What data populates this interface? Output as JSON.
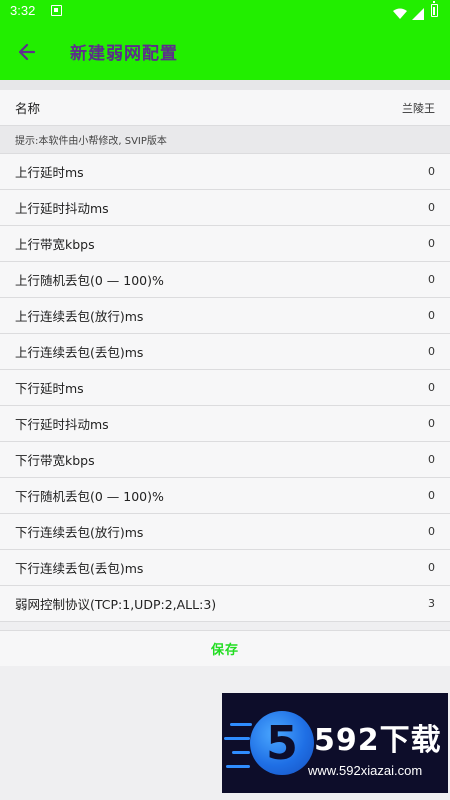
{
  "status_bar": {
    "time": "3:32"
  },
  "app_bar": {
    "title": "新建弱网配置"
  },
  "name_row": {
    "label": "名称",
    "value": "兰陵王"
  },
  "hint": "提示:本软件由小帮修改, SVIP版本",
  "settings": [
    {
      "label": "上行延时ms",
      "value": "0"
    },
    {
      "label": "上行延时抖动ms",
      "value": "0"
    },
    {
      "label": "上行带宽kbps",
      "value": "0"
    },
    {
      "label": "上行随机丢包(0 — 100)%",
      "value": "0"
    },
    {
      "label": "上行连续丢包(放行)ms",
      "value": "0"
    },
    {
      "label": "上行连续丢包(丢包)ms",
      "value": "0"
    },
    {
      "label": "下行延时ms",
      "value": "0"
    },
    {
      "label": "下行延时抖动ms",
      "value": "0"
    },
    {
      "label": "下行带宽kbps",
      "value": "0"
    },
    {
      "label": "下行随机丢包(0 — 100)%",
      "value": "0"
    },
    {
      "label": "下行连续丢包(放行)ms",
      "value": "0"
    },
    {
      "label": "下行连续丢包(丢包)ms",
      "value": "0"
    },
    {
      "label": "弱网控制协议(TCP:1,UDP:2,ALL:3)",
      "value": "3"
    }
  ],
  "save_label": "保存",
  "watermark": {
    "brand": "592下载",
    "url": "www.592xiazai.com",
    "badge": "5"
  },
  "colors": {
    "accent": "#22ee00",
    "title_text": "#5d2d8c",
    "save_text": "#22dd22"
  }
}
